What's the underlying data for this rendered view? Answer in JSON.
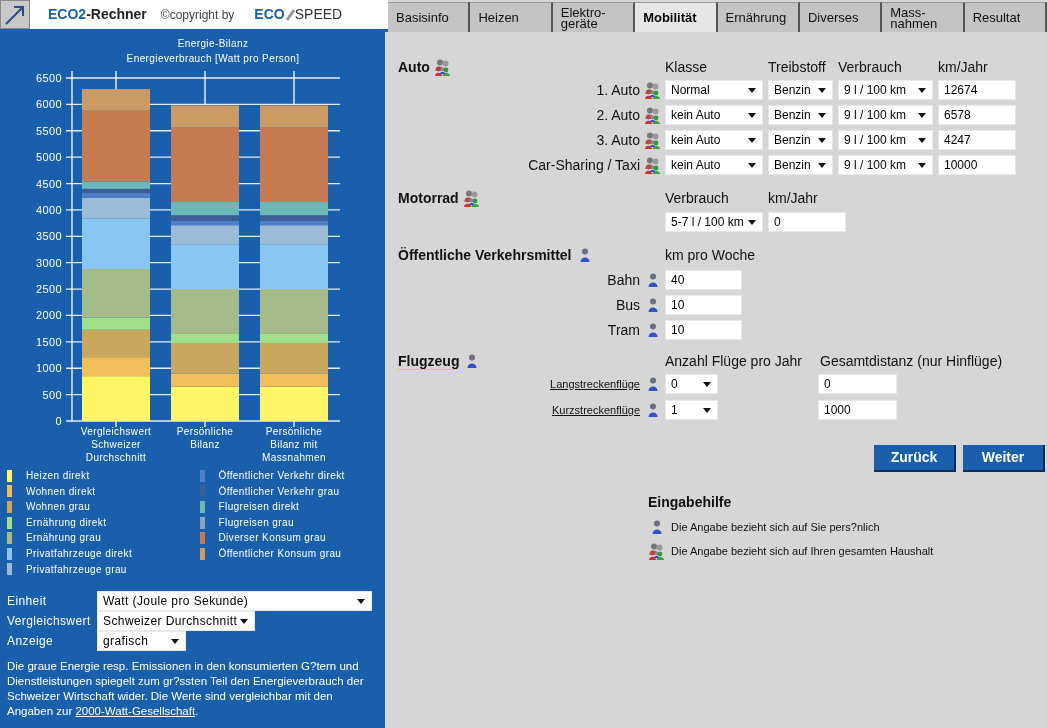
{
  "header": {
    "logo": {
      "accent": "ECO2",
      "rest": "-Rechner"
    },
    "copyright": "©copyright by",
    "brand": {
      "accent": "ECO",
      "rest": "SPEED"
    }
  },
  "tabs": [
    {
      "label": "Basisinfo",
      "selected": false
    },
    {
      "label": "Heizen",
      "selected": false
    },
    {
      "label": "Elektro-geräte",
      "selected": false
    },
    {
      "label": "Mobilität",
      "selected": true
    },
    {
      "label": "Ernährung",
      "selected": false
    },
    {
      "label": "Diverses",
      "selected": false
    },
    {
      "label": "Mass-nahmen",
      "selected": false
    },
    {
      "label": "Resultat",
      "selected": false
    }
  ],
  "energy_panel": {
    "chart_data": {
      "type": "bar",
      "stacked": true,
      "grid": true,
      "title": "Energie-Bilanz",
      "ylabel": "Energieverbrauch [Watt pro Person]",
      "categories": [
        "Vergleichswert Schweizer Durchschnitt",
        "Persönliche Bilanz",
        "Persönliche Bilanz mit Massnahmen"
      ],
      "ylim": [
        0,
        6500
      ],
      "yticks": [
        0,
        500,
        1000,
        1500,
        2000,
        2500,
        3000,
        3500,
        4000,
        4500,
        5000,
        5500,
        6000,
        6500
      ],
      "series": [
        {
          "name": "Heizen direkt",
          "color": "#fdf466",
          "values": [
            850,
            650,
            650
          ]
        },
        {
          "name": "Wohnen direkt",
          "color": "#f2be5a",
          "values": [
            360,
            250,
            250
          ]
        },
        {
          "name": "Wohnen grau",
          "color": "#c9a75d",
          "values": [
            520,
            580,
            580
          ]
        },
        {
          "name": "Ernährung direkt",
          "color": "#a0e08a",
          "values": [
            230,
            170,
            170
          ]
        },
        {
          "name": "Ernährung grau",
          "color": "#a6bb8a",
          "values": [
            920,
            850,
            850
          ]
        },
        {
          "name": "Privatfahrzeuge direkt",
          "color": "#8ac6f2",
          "values": [
            960,
            840,
            840
          ]
        },
        {
          "name": "Privatfahrzeuge grau",
          "color": "#9bbbd6",
          "values": [
            390,
            370,
            370
          ]
        },
        {
          "name": "Öffentlicher Verkehr direkt",
          "color": "#4f7fc7",
          "values": [
            90,
            80,
            80
          ]
        },
        {
          "name": "Öffentlicher Verkehr grau",
          "color": "#3b5e94",
          "values": [
            80,
            110,
            110
          ]
        },
        {
          "name": "Flugreisen direkt",
          "color": "#6cb8b8",
          "values": [
            140,
            250,
            250
          ]
        },
        {
          "name": "Flugreisen grau",
          "color": "#8aa2bd",
          "values": [
            null,
            null,
            null
          ]
        },
        {
          "name": "Diverser Konsum grau",
          "color": "#c57a52",
          "values": [
            1340,
            1410,
            1410
          ]
        },
        {
          "name": "Öffentlicher Konsum grau",
          "color": "#cc9a64",
          "values": [
            410,
            420,
            420
          ]
        }
      ]
    },
    "settings": [
      {
        "label": "Einheit",
        "value": "Watt (Joule pro Sekunde)",
        "kind": "wide"
      },
      {
        "label": "Vergleichswert",
        "value": "Schweizer Durchschnitt",
        "kind": "medium"
      },
      {
        "label": "Anzeige",
        "value": "grafisch",
        "kind": "narrow"
      }
    ],
    "note": {
      "text": "Die graue Energie resp. Emissionen in den konsumierten G?tern und Dienstleistungen spiegelt zum gr?ssten Teil den Energieverbrauch der Schweizer Wirtschaft wider. Die Werte sind vergleichbar mit den Angaben zur ",
      "link": "2000-Watt-Gesellschaft",
      "after": "."
    }
  },
  "auto": {
    "title": "Auto",
    "columns": [
      "Klasse",
      "Treibstoff",
      "Verbrauch",
      "km/Jahr"
    ],
    "rows": [
      {
        "label": "1. Auto",
        "klasse": "Normal",
        "treibstoff": "Benzin",
        "verbrauch": "9 l / 100 km",
        "km": "12674"
      },
      {
        "label": "2. Auto",
        "klasse": "kein Auto",
        "treibstoff": "Benzin",
        "verbrauch": "9 l / 100 km",
        "km": "6578"
      },
      {
        "label": "3. Auto",
        "klasse": "kein Auto",
        "treibstoff": "Benzin",
        "verbrauch": "9 l / 100 km",
        "km": "4247"
      },
      {
        "label": "Car-Sharing / Taxi",
        "klasse": "kein Auto",
        "treibstoff": "Benzin",
        "verbrauch": "9 l / 100 km",
        "km": "10000"
      }
    ]
  },
  "motorrad": {
    "title": "Motorrad",
    "columns": [
      "Verbrauch",
      "km/Jahr"
    ],
    "verbrauch": "5-7 l / 100 km",
    "km": "0"
  },
  "oev": {
    "title": "Öffentliche Verkehrsmittel",
    "column": "km pro Woche",
    "rows": [
      {
        "label": "Bahn",
        "value": "40"
      },
      {
        "label": "Bus",
        "value": "10"
      },
      {
        "label": "Tram",
        "value": "10"
      }
    ]
  },
  "flugzeug": {
    "title": "Flugzeug",
    "columns": [
      "Anzahl Flüge pro Jahr",
      "Gesamtdistanz (nur Hinflüge)"
    ],
    "rows": [
      {
        "label": "Langstreckenflüge",
        "count": "0",
        "distance": "0"
      },
      {
        "label": "Kurzstreckenflüge",
        "count": "1",
        "distance": "1000"
      }
    ]
  },
  "buttons": [
    "Zurück",
    "Weiter"
  ],
  "help": {
    "title": "Eingabehilfe",
    "items": [
      {
        "kind": "person",
        "text": "Die Angabe bezieht sich auf Sie pers?nlich"
      },
      {
        "kind": "household",
        "text": "Die Angabe bezieht sich auf Ihren gesamten Haushalt"
      }
    ]
  }
}
